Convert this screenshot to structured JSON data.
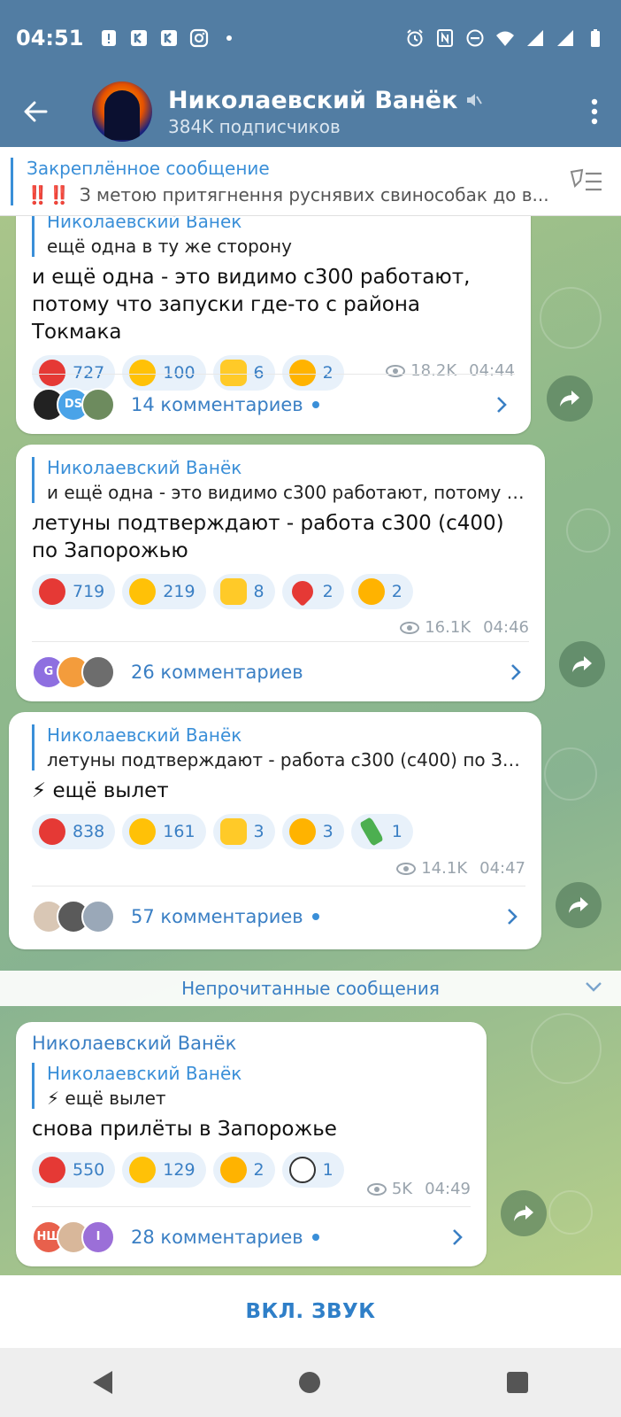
{
  "status": {
    "time": "04:51",
    "left_icons": [
      "notification-icon",
      "kb-icon",
      "kb-icon",
      "instagram-icon",
      "dot-icon"
    ],
    "right_icons": [
      "alarm-icon",
      "nfc-icon",
      "dnd-icon",
      "wifi-icon",
      "signal-icon",
      "signal-icon",
      "battery-icon"
    ]
  },
  "header": {
    "title": "Николаевский Ванёк",
    "subscribers": "384K подписчиков",
    "muted_icon": "mute-icon"
  },
  "pinned": {
    "title": "Закреплённое сообщение",
    "marks": "‼️‼️",
    "text": "З метою притягнення руснявих свинособак до в..."
  },
  "messages": [
    {
      "reply_name": "Николаевский Ванёк",
      "reply_text": "ещё одна в ту же сторону",
      "text": "и ещё одна - это видимо с300 работают, потому что запуски где-то с района Токмака",
      "reactions": [
        {
          "emoji": "angry",
          "count": "727"
        },
        {
          "emoji": "cry",
          "count": "100"
        },
        {
          "emoji": "thumbs",
          "count": "6"
        },
        {
          "emoji": "rofl",
          "count": "2"
        }
      ],
      "views": "18.2K",
      "time": "04:44",
      "comments": "14 комментариев",
      "avatars": [
        "",
        "DS",
        ""
      ]
    },
    {
      "reply_name": "Николаевский Ванёк",
      "reply_text": "и ещё одна - это видимо с300 работают, потому ч...",
      "text": "летуны подтверждают - работа с300 (с400) по Запорожью",
      "reactions": [
        {
          "emoji": "angry",
          "count": "719"
        },
        {
          "emoji": "cry",
          "count": "219"
        },
        {
          "emoji": "thumbs",
          "count": "8"
        },
        {
          "emoji": "heart",
          "count": "2"
        },
        {
          "emoji": "rofl",
          "count": "2"
        }
      ],
      "views": "16.1K",
      "time": "04:46",
      "comments": "26 комментариев",
      "avatars": [
        "G",
        "",
        ""
      ]
    },
    {
      "reply_name": "Николаевский Ванёк",
      "reply_text": "летуны подтверждают - работа с300 (с400) по За...",
      "text": "⚡ ещё вылет",
      "reactions": [
        {
          "emoji": "angry",
          "count": "838"
        },
        {
          "emoji": "cry",
          "count": "161"
        },
        {
          "emoji": "thumbs",
          "count": "3"
        },
        {
          "emoji": "rofl",
          "count": "3"
        },
        {
          "emoji": "bottle",
          "count": "1"
        }
      ],
      "views": "14.1K",
      "time": "04:47",
      "comments": "57 комментариев",
      "avatars": [
        "",
        "",
        ""
      ]
    },
    {
      "sender": "Николаевский Ванёк",
      "reply_name": "Николаевский Ванёк",
      "reply_text": "⚡ ещё вылет",
      "text": "снова прилёты в Запорожье",
      "reactions": [
        {
          "emoji": "angry",
          "count": "550"
        },
        {
          "emoji": "cry",
          "count": "129"
        },
        {
          "emoji": "rofl",
          "count": "2"
        },
        {
          "emoji": "eyes",
          "count": "1"
        }
      ],
      "views": "5K",
      "time": "04:49",
      "comments": "28 комментариев",
      "avatars": [
        "НШ",
        "",
        "I"
      ]
    }
  ],
  "unread_label": "Непрочитанные сообщения",
  "sound_button": "ВКЛ. ЗВУК",
  "colors": {
    "header": "#527da3",
    "accent": "#3a8fd8",
    "reaction_bg": "#e8f1fa"
  }
}
